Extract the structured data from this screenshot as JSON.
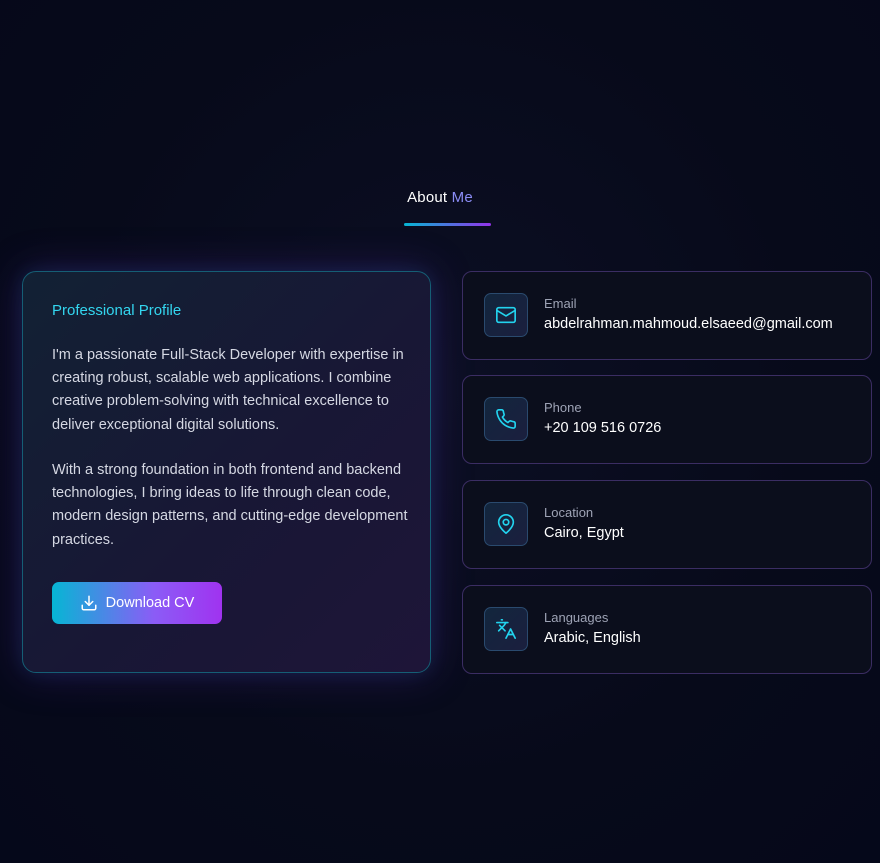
{
  "section": {
    "title_part1": "About",
    "title_part2": "Me"
  },
  "profile": {
    "heading": "Professional Profile",
    "paragraph_1": "I'm a passionate Full-Stack Developer with expertise in creating robust, scalable web applications. I combine creative problem-solving with technical excellence to deliver exceptional digital solutions.",
    "paragraph_2": "With a strong foundation in both frontend and backend technologies, I bring ideas to life through clean code, modern design patterns, and cutting-edge development practices.",
    "cv_button": {
      "label": "Download CV",
      "icon": "download-icon"
    }
  },
  "contacts": [
    {
      "label": "Email",
      "value": "abdelrahman.mahmoud.elsaeed@gmail.com",
      "icon": "mail-icon"
    },
    {
      "label": "Phone",
      "value": "+20 109 516 0726",
      "icon": "phone-icon"
    },
    {
      "label": "Location",
      "value": "Cairo, Egypt",
      "icon": "map-pin-icon"
    },
    {
      "label": "Languages",
      "value": "Arabic, English",
      "icon": "translate-icon"
    }
  ],
  "colors": {
    "background": "#070a1a",
    "accent_cyan": "#06b6d4",
    "accent_purple": "#9333ea",
    "heading_cyan": "#33d6ef"
  }
}
